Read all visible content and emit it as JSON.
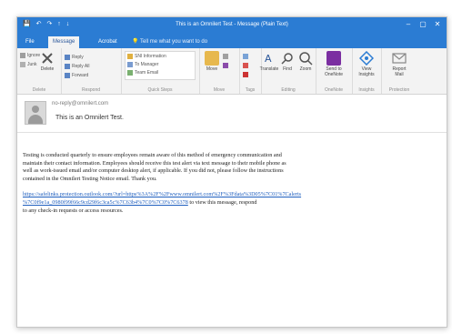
{
  "window": {
    "title": "This is an Omnilert Test - Message (Plain Text)",
    "qat_icons": [
      "save-icon",
      "undo-icon",
      "redo-icon",
      "up-icon",
      "down-icon"
    ],
    "controls": [
      "–",
      "▢",
      "✕"
    ]
  },
  "tabs": [
    {
      "label": "File",
      "active": false
    },
    {
      "label": "Message",
      "active": true
    },
    {
      "label": "Acrobat",
      "active": false
    }
  ],
  "tell_me": "Tell me what you want to do",
  "ribbon": {
    "delete_group": {
      "label": "Delete",
      "ignore": "Ignore",
      "delete": "Delete",
      "junk": "Junk"
    },
    "respond_group": {
      "label": "Respond",
      "reply": "Reply",
      "reply_all": "Reply All",
      "forward": "Forward"
    },
    "quicksteps_group": {
      "label": "Quick Steps",
      "items": [
        "SNI Information",
        "To Manager",
        "Team Email"
      ]
    },
    "move_group": {
      "label": "Move",
      "move": "Move"
    },
    "tags_group": {
      "label": "Tags"
    },
    "editing_group": {
      "label": "Editing",
      "translate": "Translate",
      "find": "Find",
      "zoom": "Zoom"
    },
    "zoom_group": {
      "label": "Zoom"
    },
    "onenote_group": {
      "label": "OneNote",
      "send_to_onenote": "Send to OneNote"
    },
    "insights_group": {
      "label": "Insights",
      "view_insights": "View Insights"
    },
    "protection_group": {
      "label": "Protection",
      "report_mail": "Report Mail"
    }
  },
  "email": {
    "from": "no-reply@omnilert.com",
    "subject": "This is an Omnilert Test.",
    "body_lines": [
      "Testing is conducted quarterly to ensure employees remain aware of this method of emergency communication and",
      "maintain their contact information. Employees should receive this test alert via text message to their mobile phone as",
      "well as work-issued email and/or computer desktop alert, if applicable. If you did not, please follow the instructions",
      "contained in the Omnilert Testing Notice email. Thank you."
    ],
    "link_line1": "https://safelinks.protection.outlook.com/?url=https%3A%2F%2Fwww.omnilert.com%2F%3Fdata%3D05%7C01%7Calerts",
    "link_line2": "%7C0f9e1a_0980f99f66c9cd29f6c3ca5c%7C63b4%7C0%7C0%7C6378",
    "link_tail": " to view this message, respond",
    "after_link": "to any check-in requests or access resources."
  }
}
